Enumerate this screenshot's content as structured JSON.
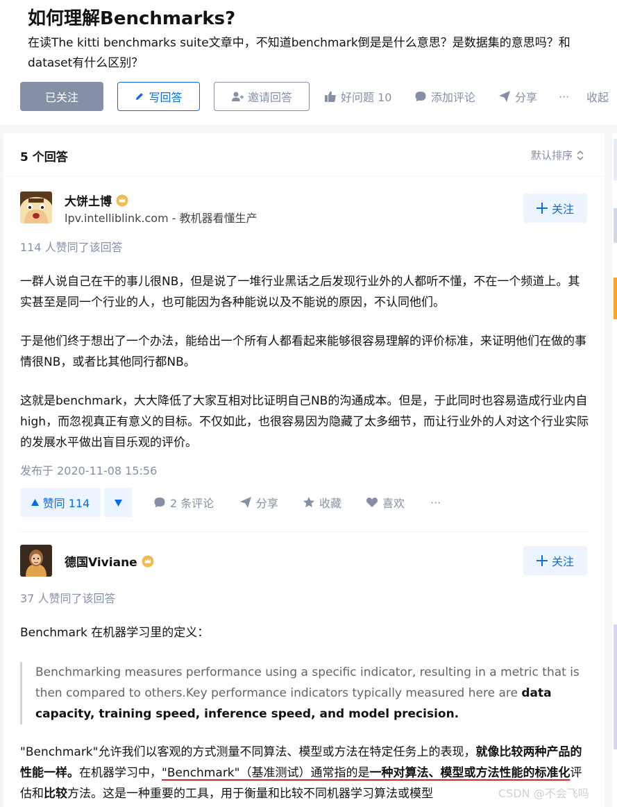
{
  "question": {
    "title": "如何理解Benchmarks?",
    "detail": "在读The kitti benchmarks suite文章中，不知道benchmark倒是是什么意思？是数据集的意思吗？和dataset有什么区别？",
    "followed_label": "已关注",
    "write_label": "写回答",
    "invite_label": "邀请回答",
    "good_question_label": "好问题 10",
    "add_comment_label": "添加评论",
    "share_label": "分享",
    "more_label": "···",
    "collapse_label": "收起"
  },
  "answers_header": {
    "count_label": "5 个回答",
    "sort_label": "默认排序"
  },
  "answer1": {
    "author": "大饼土博",
    "headline": "lpv.intelliblink.com - 教机器看懂生产",
    "follow_label": "关注",
    "votes_line": "114 人赞同了该回答",
    "paragraphs": [
      "一群人说自己在干的事儿很NB，但是说了一堆行业黑话之后发现行业外的人都听不懂，不在一个频道上。其实甚至是同一个行业的人，也可能因为各种能说以及不能说的原因，不认同他们。",
      "于是他们终于想出了一个办法，能给出一个所有人都看起来能够很容易理解的评价标准，来证明他们在做的事情很NB，或者比其他同行都NB。",
      "这就是benchmark，大大降低了大家互相对比证明自己NB的沟通成本。但是，于此同时也容易造成行业内自high，而忽视真正有意义的目标。不仅如此，也很容易因为隐藏了太多细节，而让行业外的人对这个行业实际的发展水平做出盲目乐观的评价。"
    ],
    "posted": "发布于 2020-11-08 15:56",
    "vote_label": "赞同 114",
    "comments_label": "2 条评论",
    "share_label": "分享",
    "collect_label": "收藏",
    "like_label": "喜欢",
    "more_label": "···"
  },
  "answer2": {
    "author": "德国Viviane",
    "follow_label": "关注",
    "votes_line": "37 人赞同了该回答",
    "intro": "Benchmark 在机器学习里的定义：",
    "quote_plain": "Benchmarking measures performance using a specific indicator, resulting in a metric that is then compared to others.Key performance indicators typically measured here are ",
    "quote_bold": "data capacity, training speed, inference speed, and model precision.",
    "p1_a": "\"Benchmark\"允许我们以客观的方式测量不同算法、模型或方法在特定任务上的表现，",
    "p1_b": "就像比较两种产品的性能一样。",
    "p1_c": "在机器学习中，",
    "p1_d": "\"Benchmark\"（基准测试）通常指的是",
    "p1_e": "一种对算法、模型或方法性能的标准化",
    "p1_f": "评估和",
    "p1_g": "比较",
    "p1_h": "方法",
    "p1_i": "。这是一种重要的工具，用于衡量和比较不同机器学习算法或模型"
  },
  "watermark": "CSDN @不会飞吗",
  "colors": {
    "brand_blue": "#056de8",
    "muted_gray": "#8590a6",
    "underline_red": "#d6232a"
  }
}
